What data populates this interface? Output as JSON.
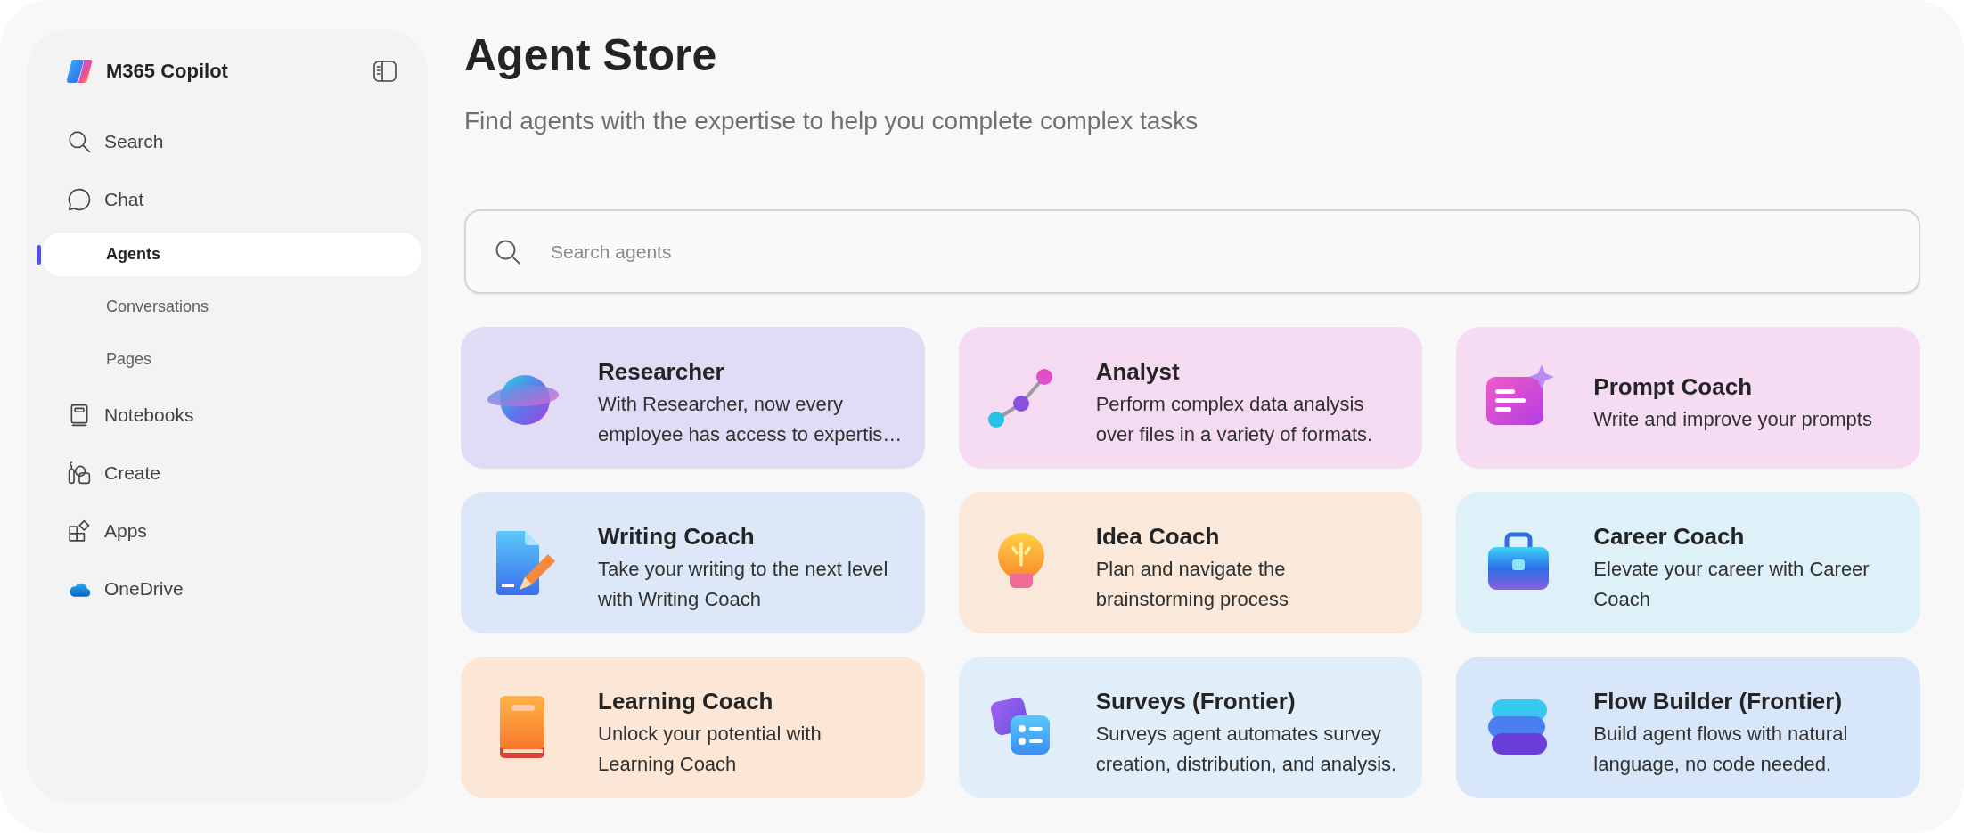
{
  "sidebar": {
    "title": "M365 Copilot",
    "items": [
      {
        "label": "Search",
        "selected": false
      },
      {
        "label": "Chat",
        "selected": false,
        "children": [
          {
            "label": "Agents",
            "selected": true
          },
          {
            "label": "Conversations",
            "selected": false
          },
          {
            "label": "Pages",
            "selected": false
          }
        ]
      },
      {
        "label": "Notebooks",
        "selected": false
      },
      {
        "label": "Create",
        "selected": false
      },
      {
        "label": "Apps",
        "selected": false
      },
      {
        "label": "OneDrive",
        "selected": false
      }
    ]
  },
  "header": {
    "title": "Agent Store",
    "subtitle": "Find agents with the expertise to help you complete complex tasks"
  },
  "search": {
    "placeholder": "Search agents"
  },
  "agents": [
    {
      "name": "Researcher",
      "description": "With Researcher, now every employee has access to expertis…",
      "color": "#e1dbf5"
    },
    {
      "name": "Analyst",
      "description": "Perform complex data analysis over files in a variety of formats.",
      "color": "#f5dbf2"
    },
    {
      "name": "Prompt Coach",
      "description": "Write and improve your prompts",
      "color": "#f6dcf3"
    },
    {
      "name": "Writing Coach",
      "description": "Take your writing to the next level with Writing Coach",
      "color": "#dce8f8"
    },
    {
      "name": "Idea Coach",
      "description": "Plan and navigate the brainstorming process",
      "color": "#fae9da"
    },
    {
      "name": "Career Coach",
      "description": "Elevate your career with Career Coach",
      "color": "#def1f8"
    },
    {
      "name": "Learning Coach",
      "description": "Unlock your potential with Learning Coach",
      "color": "#fce6d6"
    },
    {
      "name": "Surveys (Frontier)",
      "description": "Surveys agent automates survey creation, distribution, and analysis.",
      "color": "#e0eef9"
    },
    {
      "name": "Flow Builder (Frontier)",
      "description": "Build agent flows with natural language, no code needed.",
      "color": "#d7e6f8"
    }
  ]
}
